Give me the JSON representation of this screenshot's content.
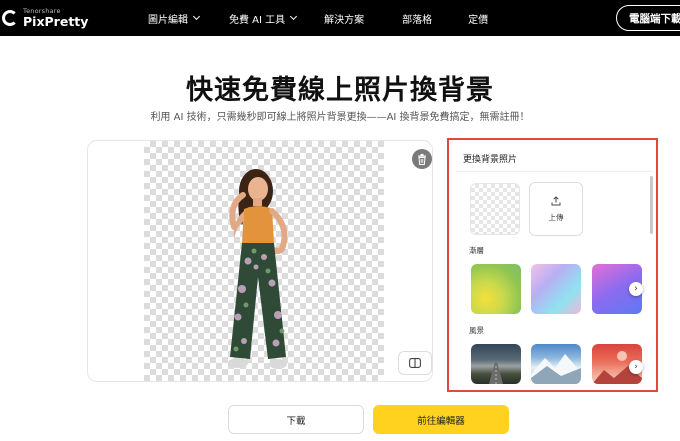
{
  "header": {
    "brand_small": "Tenorshare",
    "brand_name": "PixPretty",
    "nav": [
      {
        "label": "圖片編輯",
        "has_dropdown": true
      },
      {
        "label": "免費 AI 工具",
        "has_dropdown": true
      },
      {
        "label": "解決方案",
        "has_dropdown": false
      },
      {
        "label": "部落格",
        "has_dropdown": false
      },
      {
        "label": "定價",
        "has_dropdown": false
      }
    ],
    "cta_label": "電腦端下載"
  },
  "hero": {
    "title_part1": "快速",
    "title_highlight": "免費",
    "title_part2": "線上照片換背景",
    "subtitle": "利用 AI 技術，只需幾秒即可線上將照片背景更換——AI 換背景免費搞定，無需註冊！"
  },
  "panel": {
    "title": "更換背景照片",
    "upload_label": "上傳",
    "gradient_label": "漸層",
    "scenery_label": "風景"
  },
  "actions": {
    "download_label": "下載",
    "editor_label": "前往編輯器"
  },
  "colors": {
    "nav_bg": "#000000",
    "highlight": "#ffe23b",
    "primary_button": "#ffd21f",
    "panel_border": "#e04a3c"
  }
}
